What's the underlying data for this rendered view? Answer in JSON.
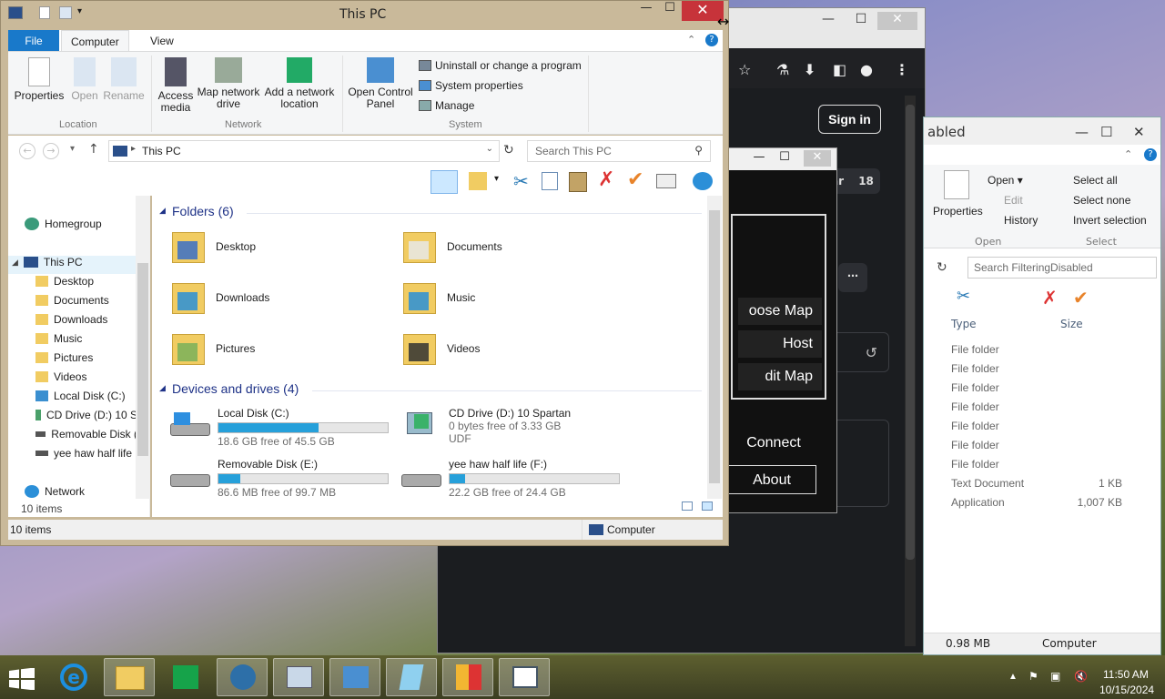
{
  "browser": {
    "sign_in": "Sign in",
    "badge_label": "ar",
    "badge_count": "18"
  },
  "game": {
    "choose_map": "oose Map",
    "host": "Host",
    "edit_map": "dit Map",
    "connect": "Connect",
    "about": "About"
  },
  "right_window": {
    "title": "abled",
    "ribbon": {
      "properties": "Properties",
      "open": "Open",
      "edit": "Edit",
      "history": "History",
      "select_all": "Select all",
      "select_none": "Select none",
      "invert_selection": "Invert selection",
      "group_open": "Open",
      "group_select": "Select"
    },
    "search_placeholder": "Search FilteringDisabled",
    "columns": {
      "type": "Type",
      "size": "Size"
    },
    "rows": [
      {
        "type": "File folder",
        "size": ""
      },
      {
        "type": "File folder",
        "size": ""
      },
      {
        "type": "File folder",
        "size": ""
      },
      {
        "type": "File folder",
        "size": ""
      },
      {
        "type": "File folder",
        "size": ""
      },
      {
        "type": "File folder",
        "size": ""
      },
      {
        "type": "File folder",
        "size": ""
      },
      {
        "type": "Text Document",
        "size": "1 KB"
      },
      {
        "type": "Application",
        "size": "1,007 KB"
      }
    ],
    "status_size": "0.98 MB",
    "status_location": "Computer"
  },
  "main_window": {
    "title": "This PC",
    "tabs": {
      "file": "File",
      "computer": "Computer",
      "view": "View"
    },
    "ribbon": {
      "properties": "Properties",
      "open": "Open",
      "rename": "Rename",
      "access_media": "Access media",
      "map_network_drive": "Map network drive",
      "add_network_location": "Add a network location",
      "open_control_panel": "Open Control Panel",
      "uninstall": "Uninstall or change a program",
      "system_properties": "System properties",
      "manage": "Manage",
      "group_location": "Location",
      "group_network": "Network",
      "group_system": "System"
    },
    "address": "This PC",
    "search_placeholder": "Search This PC",
    "nav": {
      "homegroup": "Homegroup",
      "this_pc": "This PC",
      "desktop": "Desktop",
      "documents": "Documents",
      "downloads": "Downloads",
      "music": "Music",
      "pictures": "Pictures",
      "videos": "Videos",
      "local_disk": "Local Disk (C:)",
      "cd_drive": "CD Drive (D:) 10 S",
      "removable": "Removable Disk (",
      "yee": "yee haw half life",
      "network": "Network",
      "items": "10 items"
    },
    "folders_header": "Folders (6)",
    "folders": [
      "Desktop",
      "Documents",
      "Downloads",
      "Music",
      "Pictures",
      "Videos"
    ],
    "devices_header": "Devices and drives (4)",
    "drives": [
      {
        "name": "Local Disk (C:)",
        "free": "18.6 GB free of 45.5 GB",
        "used_fraction": 0.59
      },
      {
        "name": "CD Drive (D:) 10 Spartan",
        "free": "0 bytes free of 3.33 GB",
        "fs": "UDF"
      },
      {
        "name": "Removable Disk (E:)",
        "free": "86.6 MB free of 99.7 MB",
        "used_fraction": 0.13
      },
      {
        "name": "yee haw half life (F:)",
        "free": "22.2 GB free of 24.4 GB",
        "used_fraction": 0.09
      }
    ],
    "status_items": "10 items",
    "status_location": "Computer"
  },
  "taskbar": {
    "time": "11:50 AM",
    "date": "10/15/2024"
  }
}
